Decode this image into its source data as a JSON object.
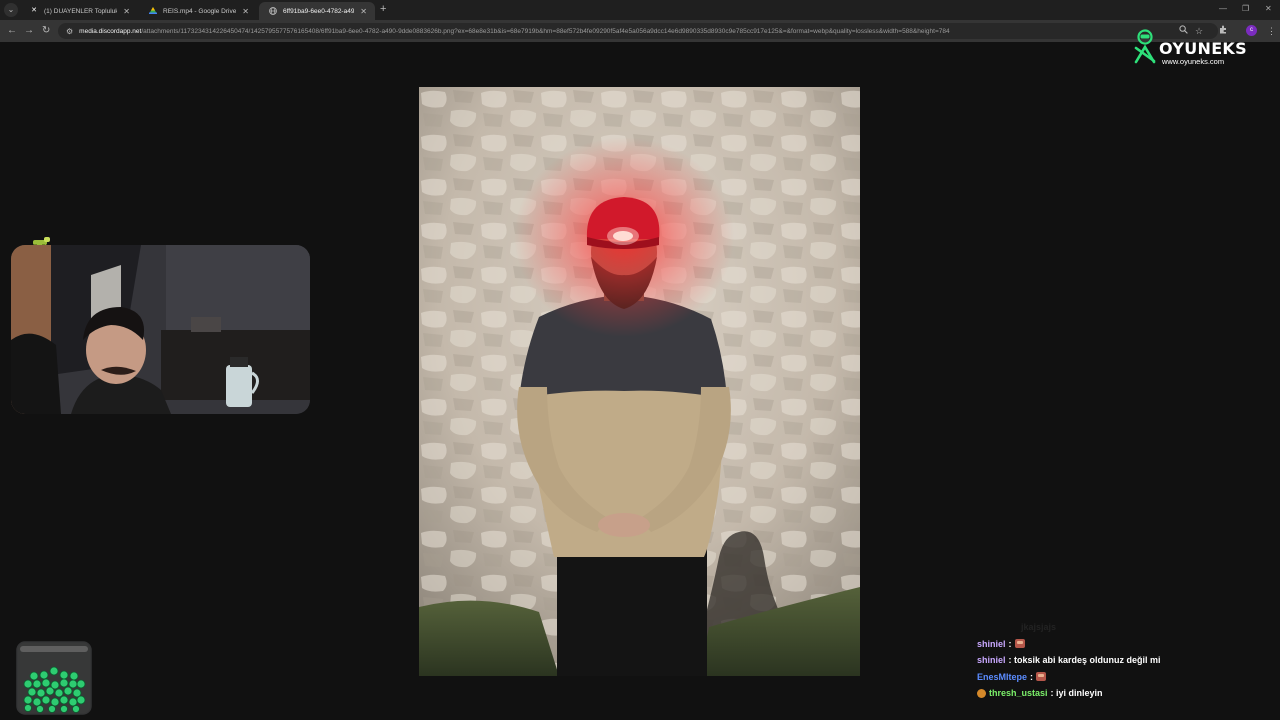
{
  "browser": {
    "tabs": [
      {
        "title": "(1) DUAYENLER Topluluk / X",
        "favicon": "x-logo-icon",
        "active": false
      },
      {
        "title": "REİS.mp4 - Google Drive",
        "favicon": "google-drive-icon",
        "active": false
      },
      {
        "title": "6ff91ba9-6ee0-4782-a490-9dd",
        "favicon": "globe-icon",
        "active": true
      }
    ],
    "new_tab": "+",
    "url_host": "media.discordapp.net",
    "url_path": "/attachments/1173234314226450474/1425795577576165408/6ff91ba9-6ee0-4782-a490-9dde0883626b.png?ex=68e8e31b&is=68e7919b&hm=88ef572b4fe09290f5af4e5a056a9dcc14e6d9890335d8930c9e785cc917e125&=&format=webp&quality=lossless&width=588&height=784",
    "profile_initial": "c"
  },
  "logo": {
    "brand": "OYUNEKS",
    "site": "www.oyuneks.com"
  },
  "chat": {
    "messages": [
      {
        "user": "",
        "text": "jkajsjajs",
        "user_color": "#9a9a9a",
        "faded": true,
        "emote": false,
        "badge": false
      },
      {
        "user": "shiniel",
        "text": "",
        "user_color": "#c9a8ff",
        "faded": false,
        "emote": true,
        "badge": false
      },
      {
        "user": "shiniel",
        "text": "toksik abi kardeş oldunuz değil mi",
        "user_color": "#c9a8ff",
        "faded": false,
        "emote": false,
        "badge": false
      },
      {
        "user": "EnesMltepe",
        "text": "",
        "user_color": "#5b8cff",
        "faded": false,
        "emote": true,
        "badge": false
      },
      {
        "user": "thresh_ustasi",
        "text": "iyi dinleyin",
        "user_color": "#7cf06a",
        "faded": false,
        "emote": false,
        "badge": true
      }
    ]
  },
  "colors": {
    "page_bg": "#111111",
    "accent_logo": "#2ee07a"
  }
}
